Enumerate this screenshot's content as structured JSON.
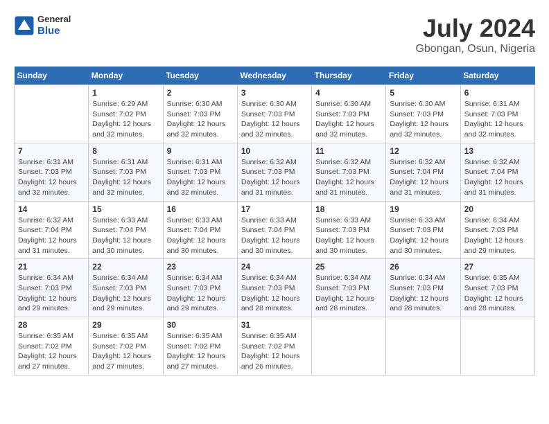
{
  "logo": {
    "general": "General",
    "blue": "Blue"
  },
  "title": "July 2024",
  "subtitle": "Gbongan, Osun, Nigeria",
  "days_of_week": [
    "Sunday",
    "Monday",
    "Tuesday",
    "Wednesday",
    "Thursday",
    "Friday",
    "Saturday"
  ],
  "weeks": [
    [
      {
        "day": "",
        "text": ""
      },
      {
        "day": "1",
        "text": "Sunrise: 6:29 AM\nSunset: 7:02 PM\nDaylight: 12 hours\nand 32 minutes."
      },
      {
        "day": "2",
        "text": "Sunrise: 6:30 AM\nSunset: 7:03 PM\nDaylight: 12 hours\nand 32 minutes."
      },
      {
        "day": "3",
        "text": "Sunrise: 6:30 AM\nSunset: 7:03 PM\nDaylight: 12 hours\nand 32 minutes."
      },
      {
        "day": "4",
        "text": "Sunrise: 6:30 AM\nSunset: 7:03 PM\nDaylight: 12 hours\nand 32 minutes."
      },
      {
        "day": "5",
        "text": "Sunrise: 6:30 AM\nSunset: 7:03 PM\nDaylight: 12 hours\nand 32 minutes."
      },
      {
        "day": "6",
        "text": "Sunrise: 6:31 AM\nSunset: 7:03 PM\nDaylight: 12 hours\nand 32 minutes."
      }
    ],
    [
      {
        "day": "7",
        "text": "Sunrise: 6:31 AM\nSunset: 7:03 PM\nDaylight: 12 hours\nand 32 minutes."
      },
      {
        "day": "8",
        "text": "Sunrise: 6:31 AM\nSunset: 7:03 PM\nDaylight: 12 hours\nand 32 minutes."
      },
      {
        "day": "9",
        "text": "Sunrise: 6:31 AM\nSunset: 7:03 PM\nDaylight: 12 hours\nand 32 minutes."
      },
      {
        "day": "10",
        "text": "Sunrise: 6:32 AM\nSunset: 7:03 PM\nDaylight: 12 hours\nand 31 minutes."
      },
      {
        "day": "11",
        "text": "Sunrise: 6:32 AM\nSunset: 7:03 PM\nDaylight: 12 hours\nand 31 minutes."
      },
      {
        "day": "12",
        "text": "Sunrise: 6:32 AM\nSunset: 7:04 PM\nDaylight: 12 hours\nand 31 minutes."
      },
      {
        "day": "13",
        "text": "Sunrise: 6:32 AM\nSunset: 7:04 PM\nDaylight: 12 hours\nand 31 minutes."
      }
    ],
    [
      {
        "day": "14",
        "text": "Sunrise: 6:32 AM\nSunset: 7:04 PM\nDaylight: 12 hours\nand 31 minutes."
      },
      {
        "day": "15",
        "text": "Sunrise: 6:33 AM\nSunset: 7:04 PM\nDaylight: 12 hours\nand 30 minutes."
      },
      {
        "day": "16",
        "text": "Sunrise: 6:33 AM\nSunset: 7:04 PM\nDaylight: 12 hours\nand 30 minutes."
      },
      {
        "day": "17",
        "text": "Sunrise: 6:33 AM\nSunset: 7:04 PM\nDaylight: 12 hours\nand 30 minutes."
      },
      {
        "day": "18",
        "text": "Sunrise: 6:33 AM\nSunset: 7:03 PM\nDaylight: 12 hours\nand 30 minutes."
      },
      {
        "day": "19",
        "text": "Sunrise: 6:33 AM\nSunset: 7:03 PM\nDaylight: 12 hours\nand 30 minutes."
      },
      {
        "day": "20",
        "text": "Sunrise: 6:34 AM\nSunset: 7:03 PM\nDaylight: 12 hours\nand 29 minutes."
      }
    ],
    [
      {
        "day": "21",
        "text": "Sunrise: 6:34 AM\nSunset: 7:03 PM\nDaylight: 12 hours\nand 29 minutes."
      },
      {
        "day": "22",
        "text": "Sunrise: 6:34 AM\nSunset: 7:03 PM\nDaylight: 12 hours\nand 29 minutes."
      },
      {
        "day": "23",
        "text": "Sunrise: 6:34 AM\nSunset: 7:03 PM\nDaylight: 12 hours\nand 29 minutes."
      },
      {
        "day": "24",
        "text": "Sunrise: 6:34 AM\nSunset: 7:03 PM\nDaylight: 12 hours\nand 28 minutes."
      },
      {
        "day": "25",
        "text": "Sunrise: 6:34 AM\nSunset: 7:03 PM\nDaylight: 12 hours\nand 28 minutes."
      },
      {
        "day": "26",
        "text": "Sunrise: 6:34 AM\nSunset: 7:03 PM\nDaylight: 12 hours\nand 28 minutes."
      },
      {
        "day": "27",
        "text": "Sunrise: 6:35 AM\nSunset: 7:03 PM\nDaylight: 12 hours\nand 28 minutes."
      }
    ],
    [
      {
        "day": "28",
        "text": "Sunrise: 6:35 AM\nSunset: 7:02 PM\nDaylight: 12 hours\nand 27 minutes."
      },
      {
        "day": "29",
        "text": "Sunrise: 6:35 AM\nSunset: 7:02 PM\nDaylight: 12 hours\nand 27 minutes."
      },
      {
        "day": "30",
        "text": "Sunrise: 6:35 AM\nSunset: 7:02 PM\nDaylight: 12 hours\nand 27 minutes."
      },
      {
        "day": "31",
        "text": "Sunrise: 6:35 AM\nSunset: 7:02 PM\nDaylight: 12 hours\nand 26 minutes."
      },
      {
        "day": "",
        "text": ""
      },
      {
        "day": "",
        "text": ""
      },
      {
        "day": "",
        "text": ""
      }
    ]
  ]
}
